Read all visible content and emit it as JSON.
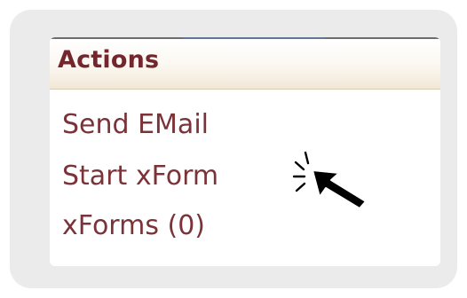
{
  "panel": {
    "title": "Actions",
    "links": [
      {
        "label": "Send EMail"
      },
      {
        "label": "Start xForm"
      },
      {
        "label": "xForms (0)"
      }
    ]
  },
  "colors": {
    "link": "#7a3338",
    "title": "#73262b",
    "frame_bg": "#ebebeb"
  },
  "icons": {
    "cursor": "pointer-arrow-icon",
    "click": "click-burst-icon"
  }
}
